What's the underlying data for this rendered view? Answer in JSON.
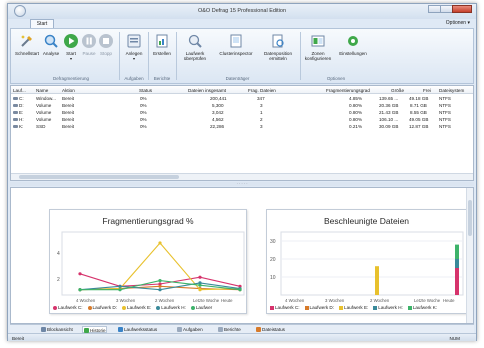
{
  "window": {
    "title": "O&O Defrag 15 Professional Edition"
  },
  "ribbon_tab": "Start",
  "options_label": "Optionen ▾",
  "ribbon": {
    "groups": [
      {
        "label": "Defragmentierung",
        "buttons": [
          "Schnellstart",
          "Analyse",
          "Start",
          "Pause",
          "Stopp"
        ]
      },
      {
        "label": "Aufgaben",
        "buttons": [
          "Anlegen"
        ]
      },
      {
        "label": "Berichte",
        "buttons": [
          "Erstellen"
        ]
      },
      {
        "label": "Datenträger",
        "buttons": [
          "Laufwerk überprüfen",
          "Clusterinspector",
          "Datenposition ermitteln"
        ]
      },
      {
        "label": "Optionen",
        "buttons": [
          "Zonen konfigurieren",
          "Einstellungen"
        ]
      }
    ],
    "colors": {
      "analyse": "#3a83c7",
      "start": "#3fa84a",
      "pause": "#b9c3cf",
      "stopp": "#b9c3cf"
    }
  },
  "drive_list": {
    "headers": [
      "Lauf...",
      "Name",
      "Aktion",
      "Status",
      "Dateien insgesamt",
      "Frag. Dateien",
      "Fragmentierungsgrad",
      "Größe",
      "Frei",
      "Dateisystem"
    ],
    "rows": [
      [
        "C:",
        "Window...",
        "Bereit",
        "0%",
        "200,441",
        "347",
        "4.85%",
        "139.65 ...",
        "49.18 GB",
        "NTFS"
      ],
      [
        "D:",
        "Volume",
        "Bereit",
        "0%",
        "5,300",
        "3",
        "0.80%",
        "20.36 GB",
        "8.71 GB",
        "NTFS"
      ],
      [
        "E:",
        "Volume",
        "Bereit",
        "0%",
        "3,042",
        "1",
        "0.80%",
        "21.43 GB",
        "8.55 GB",
        "NTFS"
      ],
      [
        "H:",
        "Volume",
        "Bereit",
        "0%",
        "4,562",
        "2",
        "0.80%",
        "106.10 ...",
        "49.05 GB",
        "NTFS"
      ],
      [
        "K:",
        "SSD",
        "Bereit",
        "0%",
        "22,286",
        "3",
        "0.21%",
        "30.09 GB",
        "12.87 GB",
        "NTFS"
      ]
    ]
  },
  "charts": {
    "left_title": "Fragmentierungsgrad %",
    "right_title": "Beschleunigte Dateien",
    "left_y_ticks": [
      "2",
      "4"
    ],
    "right_y_ticks": [
      "10",
      "20",
      "30"
    ],
    "left_x_ticks": [
      "4 Wochen",
      "3 Wochen",
      "2 Wochen",
      "Letzte Woche",
      "Heute"
    ],
    "right_x_ticks": [
      "4 Wochen",
      "3 Wochen",
      "2 Wochen",
      "Letzte Woche",
      "Heute"
    ],
    "legend": [
      "Laufwerk C:",
      "Laufwerk D:",
      "Laufwerk E:",
      "Laufwerk H:",
      "Laufwer"
    ],
    "legend_right": [
      "Laufwerk C:",
      "Laufwerk D:",
      "Laufwerk E:",
      "Laufwerk H:",
      "Laufwerk K:"
    ],
    "series_colors": [
      "#d6336c",
      "#d77a2a",
      "#e8c12d",
      "#3a8a9a",
      "#3db36a"
    ]
  },
  "chart_data": [
    {
      "type": "line",
      "title": "Fragmentierungsgrad %",
      "x": [
        "4 Wochen",
        "3 Wochen",
        "2 Wochen",
        "Letzte Woche",
        "Heute"
      ],
      "ylim": [
        0,
        5
      ],
      "series": [
        {
          "name": "Laufwerk C:",
          "values": [
            1.6,
            0.5,
            0.7,
            1.3,
            0.5
          ]
        },
        {
          "name": "Laufwerk D:",
          "values": [
            0.2,
            0.3,
            0.5,
            0.3,
            0.2
          ]
        },
        {
          "name": "Laufwerk E:",
          "values": [
            0.2,
            0.3,
            4.3,
            0.2,
            0.3
          ]
        },
        {
          "name": "Laufwerk H:",
          "values": [
            0.2,
            0.5,
            0.2,
            0.8,
            0.3
          ]
        },
        {
          "name": "Laufwer",
          "values": [
            0.2,
            0.2,
            1.0,
            0.6,
            0.2
          ]
        }
      ]
    },
    {
      "type": "bar",
      "title": "Beschleunigte Dateien",
      "categories": [
        "4 Wochen",
        "3 Wochen",
        "2 Wochen",
        "Letzte Woche",
        "Heute"
      ],
      "ylim": [
        0,
        35
      ],
      "series": [
        {
          "name": "Laufwerk C:",
          "values": [
            0,
            0,
            0,
            0,
            15
          ]
        },
        {
          "name": "Laufwerk E:",
          "values": [
            0,
            0,
            16,
            0,
            0
          ]
        },
        {
          "name": "Laufwerk H:",
          "values": [
            0,
            0,
            0,
            0,
            5
          ]
        },
        {
          "name": "Laufwerk K:",
          "values": [
            0,
            0,
            0,
            0,
            8
          ]
        }
      ]
    }
  ],
  "bottom_tabs": [
    "Blockansicht",
    "Historie",
    "Laufwerksstatus",
    "Aufgaben",
    "Berichte",
    "Dateistatus"
  ],
  "status": {
    "left": "Bereit",
    "right": "NUM"
  }
}
